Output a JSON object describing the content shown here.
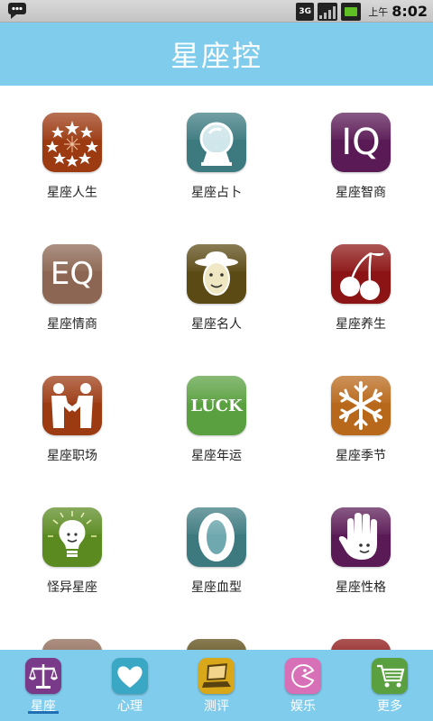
{
  "status_bar": {
    "network": "3G",
    "ampm": "上午",
    "time": "8:02"
  },
  "header": {
    "title": "星座控"
  },
  "grid": {
    "items": [
      {
        "label": "星座人生",
        "icon": "stars-icon",
        "color": "#9c3a12"
      },
      {
        "label": "星座占卜",
        "icon": "crystal-ball-icon",
        "color": "#3c7a80"
      },
      {
        "label": "星座智商",
        "icon": "iq-icon",
        "color": "#5a1a55",
        "text": "IQ"
      },
      {
        "label": "星座情商",
        "icon": "eq-icon",
        "color": "#8c6652",
        "text": "EQ"
      },
      {
        "label": "星座名人",
        "icon": "celebrity-face-icon",
        "color": "#5b4a14"
      },
      {
        "label": "星座养生",
        "icon": "cherry-icon",
        "color": "#8c1414"
      },
      {
        "label": "星座职场",
        "icon": "handshake-icon",
        "color": "#9c3a12"
      },
      {
        "label": "星座年运",
        "icon": "luck-icon",
        "color": "#5aa040",
        "text": "LUCK"
      },
      {
        "label": "星座季节",
        "icon": "snowflake-icon",
        "color": "#b8681a"
      },
      {
        "label": "怪异星座",
        "icon": "lightbulb-icon",
        "color": "#5a8a20"
      },
      {
        "label": "星座血型",
        "icon": "blood-type-o-icon",
        "color": "#3c7a80",
        "text": "O"
      },
      {
        "label": "星座性格",
        "icon": "hand-face-icon",
        "color": "#5a1a55"
      }
    ],
    "partial_row_colors": [
      "#8c6652",
      "#5b4a14",
      "#8c1414"
    ]
  },
  "tab_bar": {
    "tabs": [
      {
        "label": "星座",
        "icon": "scales-icon",
        "color": "#7a3a8a",
        "selected": true
      },
      {
        "label": "心理",
        "icon": "heart-icon",
        "color": "#3aa8c4"
      },
      {
        "label": "测评",
        "icon": "laptop-icon",
        "color": "#d8a81a"
      },
      {
        "label": "娱乐",
        "icon": "pacman-icon",
        "color": "#d870b8"
      },
      {
        "label": "更多",
        "icon": "shopping-cart-icon",
        "color": "#5aa040"
      }
    ]
  }
}
